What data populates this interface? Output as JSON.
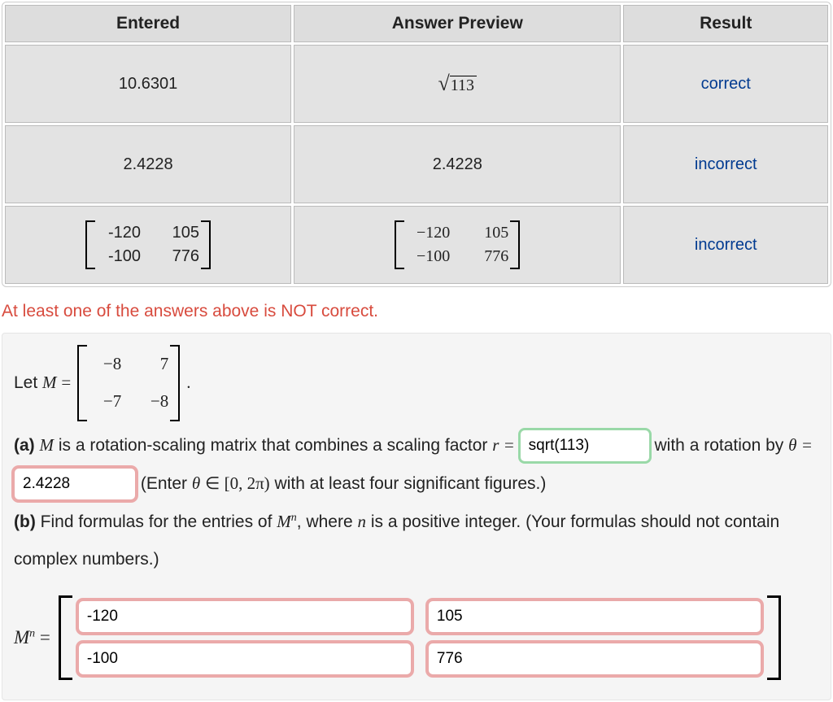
{
  "table": {
    "headers": {
      "entered": "Entered",
      "preview": "Answer Preview",
      "result": "Result"
    },
    "rows": [
      {
        "entered": "10.6301",
        "preview_type": "sqrt",
        "preview_radicand": "113",
        "result": "correct",
        "result_class": "result-correct"
      },
      {
        "entered": "2.4228",
        "preview_type": "text",
        "preview_text": "2.4228",
        "result": "incorrect",
        "result_class": "result-incorrect"
      },
      {
        "entered_type": "matrix",
        "entered_matrix": [
          "-120",
          "105",
          "-100",
          "776"
        ],
        "preview_type": "matrix_serif",
        "preview_matrix": [
          "−120",
          "105",
          "−100",
          "776"
        ],
        "result": "incorrect",
        "result_class": "result-incorrect"
      }
    ]
  },
  "warning": "At least one of the answers above is NOT correct.",
  "problem": {
    "letM": "Let ",
    "M_matrix": [
      "−8",
      "7",
      "−7",
      "−8"
    ],
    "a_lead": "(a) ",
    "a_text1": " is a rotation-scaling matrix that combines a scaling factor ",
    "r_eq": "r =",
    "input_r": "sqrt(113)",
    "with_a": " with a",
    "rotation_by": "rotation by ",
    "theta_eq": "θ =",
    "input_theta": "2.4228",
    "theta_hint": "(Enter θ ∈ [0, 2π) with at least four significant figures.)",
    "b_lead": "(b) ",
    "b_text": "Find formulas for the entries of ",
    "Mn": "Mⁿ",
    "b_text2": ", where ",
    "n_var": "n",
    "b_text3": " is a positive integer. (Your formulas should not contain complex numbers.)",
    "Mn_eq_label": "Mⁿ =",
    "matrix_inputs": {
      "a11": "-120",
      "a12": "105",
      "a21": "-100",
      "a22": "776"
    }
  }
}
